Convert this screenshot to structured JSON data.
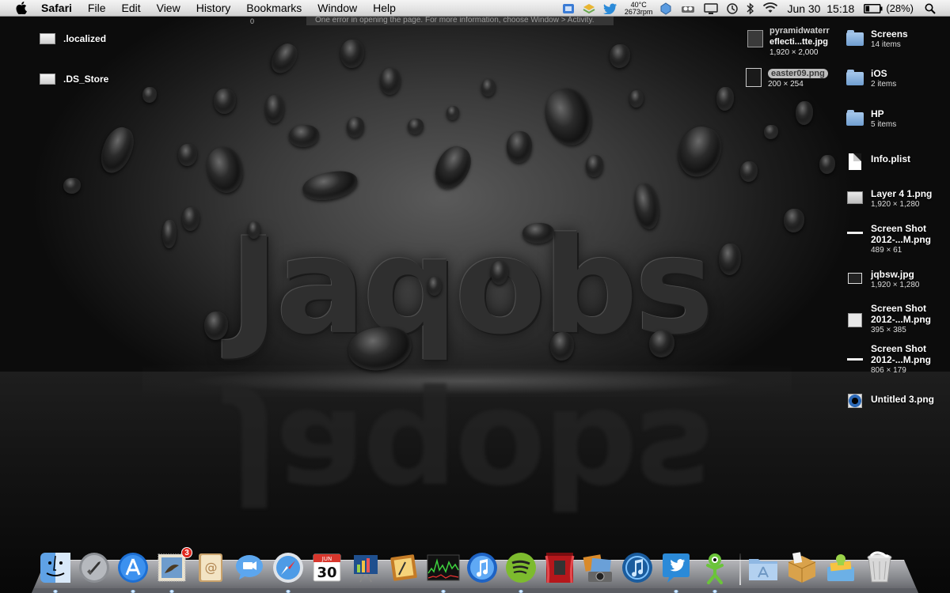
{
  "menubar": {
    "app_name": "Safari",
    "menus": [
      "File",
      "Edit",
      "View",
      "History",
      "Bookmarks",
      "Window",
      "Help"
    ],
    "weather_temp": "40°C",
    "fan_speed": "2673rpm",
    "date": "Jun 30",
    "time": "15:18",
    "battery": "(28%)",
    "battery_level": 0.28
  },
  "safari_hint": {
    "message": "One error in opening the page. For more information, choose Window > Activity.",
    "indicator": "0"
  },
  "desktop_files": [
    {
      "name": ".localized"
    },
    {
      "name": ".DS_Store"
    }
  ],
  "wallpaper_text": "Jaqobs",
  "recent_items": [
    {
      "name_line1": "pyramidwaterr",
      "name_line2": "eflecti...tte.jpg",
      "dims": "1,920 × 2,000"
    },
    {
      "name": "easter09.png",
      "dims": "200 × 254"
    }
  ],
  "stack": [
    {
      "name": "Screens",
      "sub": "14 items",
      "icon": "folder-icon"
    },
    {
      "name": "iOS",
      "sub": "2 items",
      "icon": "folder-icon"
    },
    {
      "name": "HP",
      "sub": "5 items",
      "icon": "folder-icon"
    },
    {
      "name": "Info.plist",
      "sub": "",
      "icon": "document-icon"
    },
    {
      "name": "Layer 4 1.png",
      "sub": "1,920 × 1,280",
      "icon": "image-icon"
    },
    {
      "name": "Screen Shot",
      "name2": "2012-...M.png",
      "sub": "489 × 61",
      "icon": "image-icon"
    },
    {
      "name": "jqbsw.jpg",
      "sub": "1,920 × 1,280",
      "icon": "image-icon"
    },
    {
      "name": "Screen Shot",
      "name2": "2012-...M.png",
      "sub": "395 × 385",
      "icon": "image-icon"
    },
    {
      "name": "Screen Shot",
      "name2": "2012-...M.png",
      "sub": "806 × 179",
      "icon": "image-icon"
    },
    {
      "name": "Untitled 3.png",
      "sub": "",
      "icon": "image-icon"
    }
  ],
  "dock": {
    "calendar_month": "JUN",
    "calendar_day": "30",
    "mail_badge": "3",
    "apps": [
      "Finder",
      "Launchpad",
      "App Store",
      "Mail",
      "Address Book",
      "iChat",
      "Safari",
      "iCal",
      "Keynote",
      "iPhoto",
      "Activity Monitor",
      "iTunes",
      "Spotify",
      "Photo Booth",
      "Image Capture",
      "Audio",
      "Twitter",
      "Mascot",
      "Applications",
      "Archive",
      "Downloads",
      "Trash"
    ]
  },
  "colors": {
    "menubar": "#e2e2e2",
    "accent_blue": "#2d6ab8"
  }
}
